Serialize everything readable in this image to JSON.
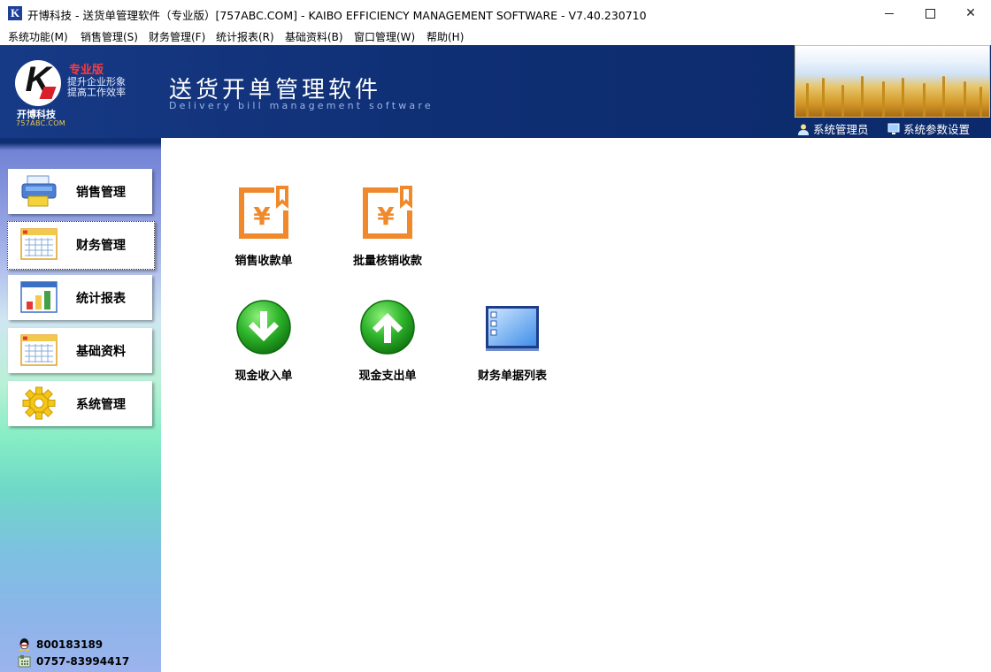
{
  "window": {
    "title": "开博科技 - 送货单管理软件（专业版）[757ABC.COM] - KAIBO EFFICIENCY MANAGEMENT SOFTWARE - V7.40.230710",
    "app_icon_letter": "K"
  },
  "menu": [
    {
      "label": "系统功能(M)"
    },
    {
      "label": "销售管理(S)"
    },
    {
      "label": "财务管理(F)"
    },
    {
      "label": "统计报表(R)"
    },
    {
      "label": "基础资料(B)"
    },
    {
      "label": "窗口管理(W)"
    },
    {
      "label": "帮助(H)"
    }
  ],
  "banner": {
    "edition": "专业版",
    "slogan_line1": "提升企业形象",
    "slogan_line2": "提高工作效率",
    "company": "开博科技",
    "domain": "757ABC.COM",
    "software_name": "送货开单管理软件",
    "software_name_en": "Delivery bill management software",
    "user_label": "系统管理员",
    "settings_label": "系统参数设置"
  },
  "sidebar": {
    "items": [
      {
        "label": "销售管理",
        "icon": "printer-icon",
        "active": false
      },
      {
        "label": "财务管理",
        "icon": "calendar-grid-icon",
        "active": true
      },
      {
        "label": "统计报表",
        "icon": "bar-chart-icon",
        "active": false
      },
      {
        "label": "基础资料",
        "icon": "calendar-grid-icon",
        "active": false
      },
      {
        "label": "系统管理",
        "icon": "gear-icon",
        "active": false
      }
    ],
    "contacts": [
      {
        "icon": "qq-icon",
        "text": "800183189"
      },
      {
        "icon": "phone-icon",
        "text": "0757-83994417"
      }
    ]
  },
  "tiles": [
    {
      "label": "销售收款单",
      "icon": "yen-receipt-icon"
    },
    {
      "label": "批量核销收款",
      "icon": "yen-receipt-icon"
    },
    {
      "label": "现金收入单",
      "icon": "arrow-down-circle-icon"
    },
    {
      "label": "现金支出单",
      "icon": "arrow-up-circle-icon"
    },
    {
      "label": "财务单据列表",
      "icon": "list-window-icon"
    }
  ],
  "colors": {
    "banner_bg": "#0f2f74",
    "edition_red": "#ff3b3b",
    "tile_orange": "#f0892b",
    "tile_green": "#22a524"
  }
}
